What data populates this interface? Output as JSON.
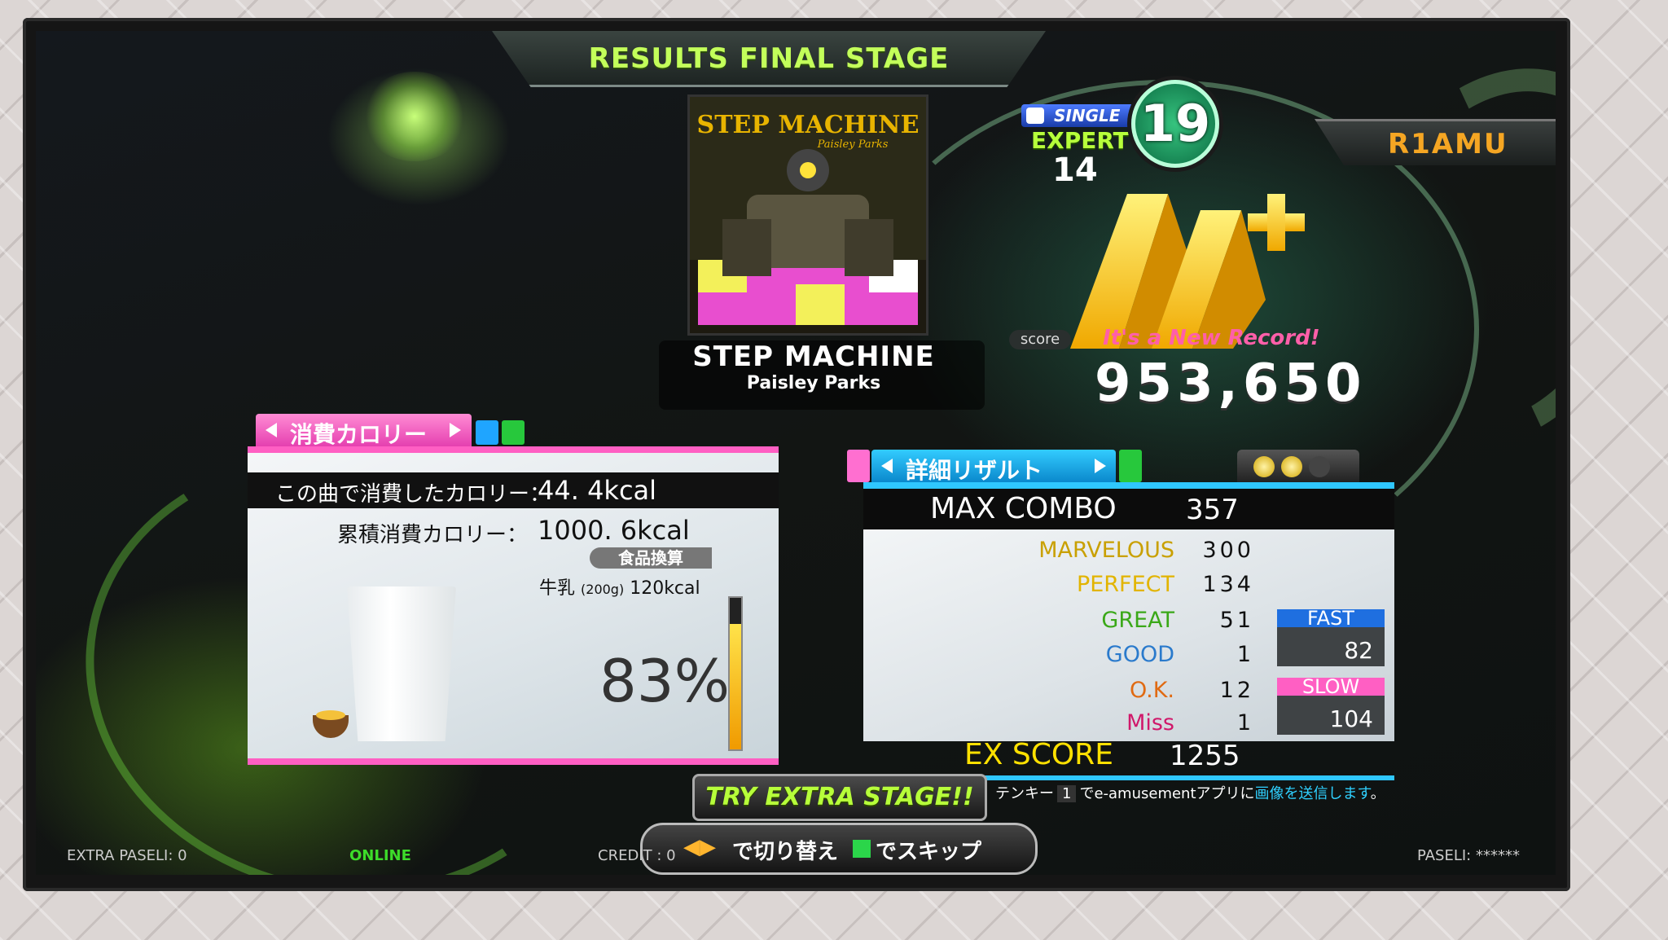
{
  "header": {
    "title": "RESULTS FINAL STAGE"
  },
  "song": {
    "title": "STEP MACHINE",
    "artist": "Paisley Parks",
    "jacket_title": "STEP MACHINE",
    "jacket_artist": "Paisley Parks"
  },
  "chart": {
    "style": "SINGLE",
    "difficulty": "EXPERT",
    "steps": "14",
    "level": "19"
  },
  "player": {
    "name": "R1AMU"
  },
  "result": {
    "grade": "AA+",
    "score_label": "score",
    "new_record": "It's a New Record!",
    "score": "953,650",
    "tab_label": "詳細リザルト",
    "max_combo_label": "MAX COMBO",
    "max_combo": "357",
    "judgements": [
      {
        "label": "MARVELOUS",
        "value": "300",
        "color": "#c9a000"
      },
      {
        "label": "PERFECT",
        "value": "134",
        "color": "#e2b400"
      },
      {
        "label": "GREAT",
        "value": "51",
        "color": "#3aa818"
      },
      {
        "label": "GOOD",
        "value": "1",
        "color": "#2a7acc"
      },
      {
        "label": "O.K.",
        "value": "12",
        "color": "#e06a12"
      },
      {
        "label": "Miss",
        "value": "1",
        "color": "#d0186a"
      }
    ],
    "fast_label": "FAST",
    "fast": "82",
    "slow_label": "SLOW",
    "slow": "104",
    "ex_label": "EX SCORE",
    "ex_score": "1255"
  },
  "calorie": {
    "tab_label": "消費カロリー",
    "song_label": "この曲で消費したカロリー：",
    "song_value": "44. 4kcal",
    "total_label": "累積消費カロリー：",
    "total_value": "1000. 6kcal",
    "food_badge": "食品換算",
    "food_name": "牛乳",
    "food_amount": "(200g)",
    "food_kcal": "120kcal",
    "percent": "83%",
    "percent_value": 83
  },
  "tenkey": {
    "prefix": "テンキー",
    "key": "1",
    "mid": "でe-amusementアプリに",
    "highlight": "画像を送信します",
    "suffix": "。"
  },
  "buttons": {
    "extra": "TRY EXTRA STAGE!!",
    "switch": "で切り替え",
    "skip": "でスキップ"
  },
  "footer": {
    "extra_paseli": "EXTRA PASELI: 0",
    "online": "ONLINE",
    "credit": "CREDIT : 0",
    "paseli": "PASELI: ******"
  },
  "colors": {
    "calorie_accent": "#ff5fc3",
    "result_accent": "#2fc7ff",
    "header_text": "#c3ff5a",
    "player_name": "#f5a623",
    "new_record": "#ff5fa9",
    "ex_score": "#ffe100"
  }
}
